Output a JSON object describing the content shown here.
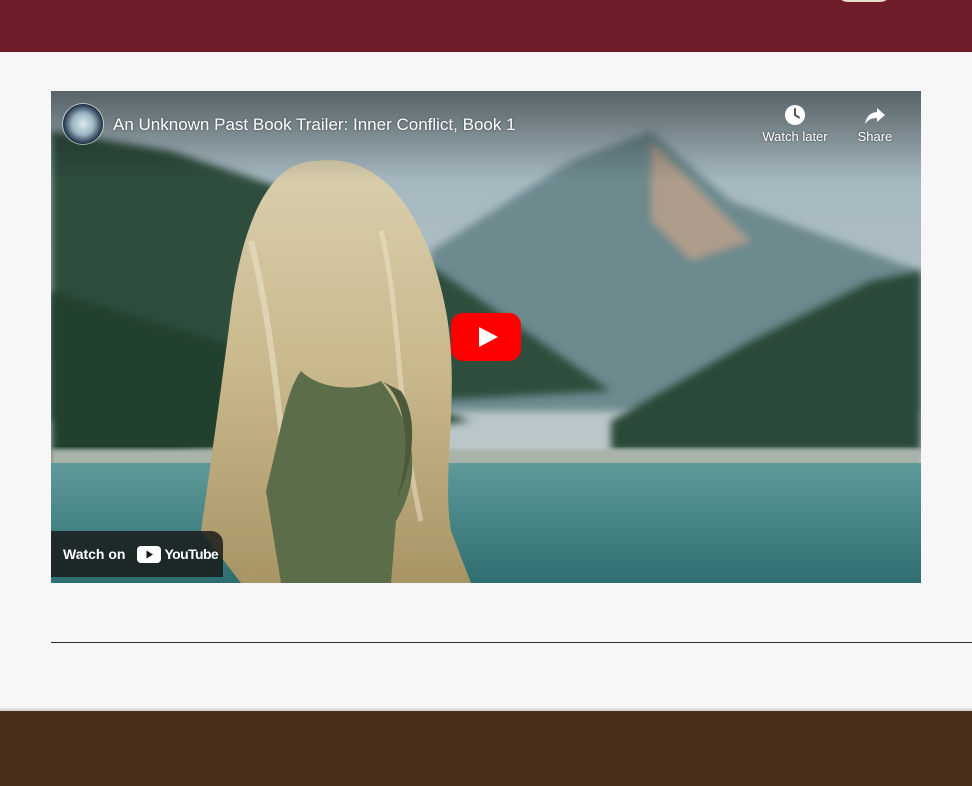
{
  "header": {
    "background_color": "#6e1c2a"
  },
  "video": {
    "title": "An Unknown Past Book Trailer: Inner Conflict, Book 1",
    "watch_later_label": "Watch later",
    "share_label": "Share",
    "watch_on_label": "Watch on",
    "youtube_wordmark": "YouTube",
    "play_button_color": "#ff0000",
    "icons": {
      "avatar": "globe-channel-avatar",
      "watch_later": "clock-icon",
      "share": "share-arrow-icon",
      "play": "play-icon",
      "youtube": "youtube-logo-icon"
    }
  },
  "footer": {
    "background_color": "#4a2f1b"
  }
}
